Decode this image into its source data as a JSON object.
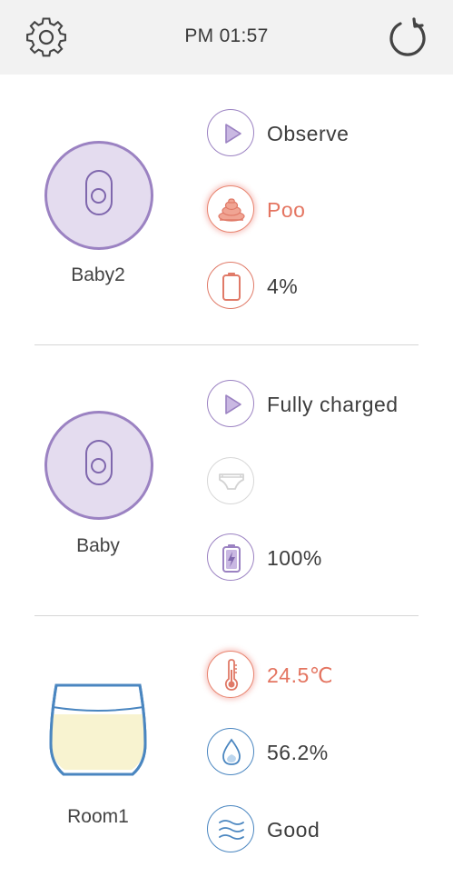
{
  "header": {
    "time": "PM 01:57"
  },
  "devices": [
    {
      "name": "Baby2",
      "mode": {
        "label": "Observe"
      },
      "diaper": {
        "label": "Poo"
      },
      "battery": {
        "label": "4%"
      }
    },
    {
      "name": "Baby",
      "mode": {
        "label": "Fully charged"
      },
      "diaper": {
        "label": ""
      },
      "battery": {
        "label": "100%"
      }
    }
  ],
  "room": {
    "name": "Room1",
    "temperature": "24.5℃",
    "humidity": "56.2%",
    "air": "Good"
  },
  "colors": {
    "accent": "#9b82c2",
    "alert": "#e47561",
    "blue": "#4a86c0",
    "header_bg": "#f2f2f2"
  }
}
